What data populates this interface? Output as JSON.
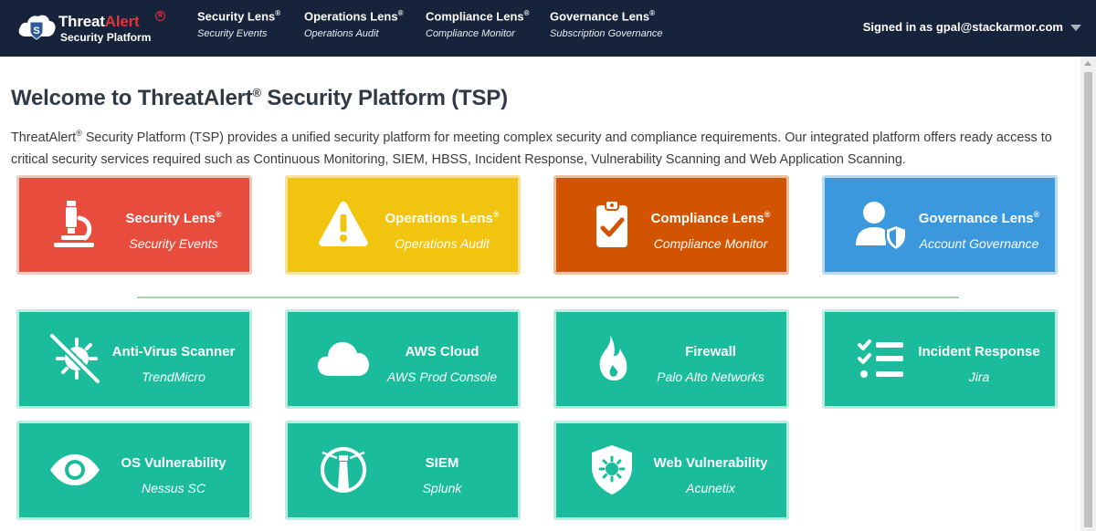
{
  "brand": {
    "name_part1": "Threat",
    "name_part2": "Alert",
    "registered_mark": "R",
    "subtitle": "Security Platform"
  },
  "nav": [
    {
      "title": "Security Lens",
      "sub": "Security Events"
    },
    {
      "title": "Operations Lens",
      "sub": "Operations Audit"
    },
    {
      "title": "Compliance Lens",
      "sub": "Compliance Monitor"
    },
    {
      "title": "Governance Lens",
      "sub": "Subscription Governance"
    }
  ],
  "nav_reg_mark": "®",
  "user": {
    "signed_in_text": "Signed in as gpal@stackarmor.com"
  },
  "page": {
    "title_part1": "Welcome to ThreatAlert",
    "title_reg": "®",
    "title_part2": " Security Platform (TSP)",
    "intro_part1": "ThreatAlert",
    "intro_reg": "®",
    "intro_part2": " Security Platform (TSP) provides a unified security platform for meeting complex security and compliance requirements. Our integrated platform offers ready access to critical security services required such as Continuous Monitoring, SIEM, HBSS, Incident Response, Vulnerability Scanning and Web Application Scanning."
  },
  "lens_tiles": [
    {
      "title": "Security Lens",
      "sub": "Security Events",
      "icon": "microscope-icon",
      "color": "#e74c3c"
    },
    {
      "title": "Operations Lens",
      "sub": "Operations Audit",
      "icon": "warning-icon",
      "color": "#f1c40f"
    },
    {
      "title": "Compliance Lens",
      "sub": "Compliance Monitor",
      "icon": "clipboard-check-icon",
      "color": "#d35400"
    },
    {
      "title": "Governance Lens",
      "sub": "Account Governance",
      "icon": "user-shield-icon",
      "color": "#3b98dc"
    }
  ],
  "tile_reg_mark": "®",
  "service_tiles": [
    {
      "title": "Anti-Virus Scanner",
      "sub": "TrendMicro",
      "icon": "virus-slash-icon"
    },
    {
      "title": "AWS Cloud",
      "sub": "AWS Prod Console",
      "icon": "cloud-icon"
    },
    {
      "title": "Firewall",
      "sub": "Palo Alto Networks",
      "icon": "fire-icon"
    },
    {
      "title": "Incident Response",
      "sub": "Jira",
      "icon": "checklist-icon"
    },
    {
      "title": "OS Vulnerability",
      "sub": "Nessus SC",
      "icon": "eye-icon"
    },
    {
      "title": "SIEM",
      "sub": "Splunk",
      "icon": "lighthouse-icon"
    },
    {
      "title": "Web Vulnerability",
      "sub": "Acunetix",
      "icon": "shield-virus-icon"
    }
  ],
  "service_color": "#1abc9c"
}
